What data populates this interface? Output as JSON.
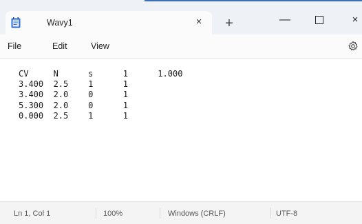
{
  "window": {
    "tab_title": "Wavy1",
    "tab_close_glyph": "×",
    "new_tab_glyph": "+",
    "minimize_glyph": "—",
    "close_glyph": "×",
    "accent_color": "#3d6fb6"
  },
  "menu": {
    "items": [
      "File",
      "Edit",
      "View"
    ]
  },
  "editor": {
    "lines": [
      "CV     N      s      1      1.000",
      "3.400  2.5    1      1",
      "3.400  2.0    0      1",
      "5.300  2.0    0      1",
      "0.000  2.5    1      1"
    ]
  },
  "status": {
    "position": "Ln 1, Col 1",
    "zoom": "100%",
    "line_ending": "Windows (CRLF)",
    "encoding": "UTF-8"
  }
}
